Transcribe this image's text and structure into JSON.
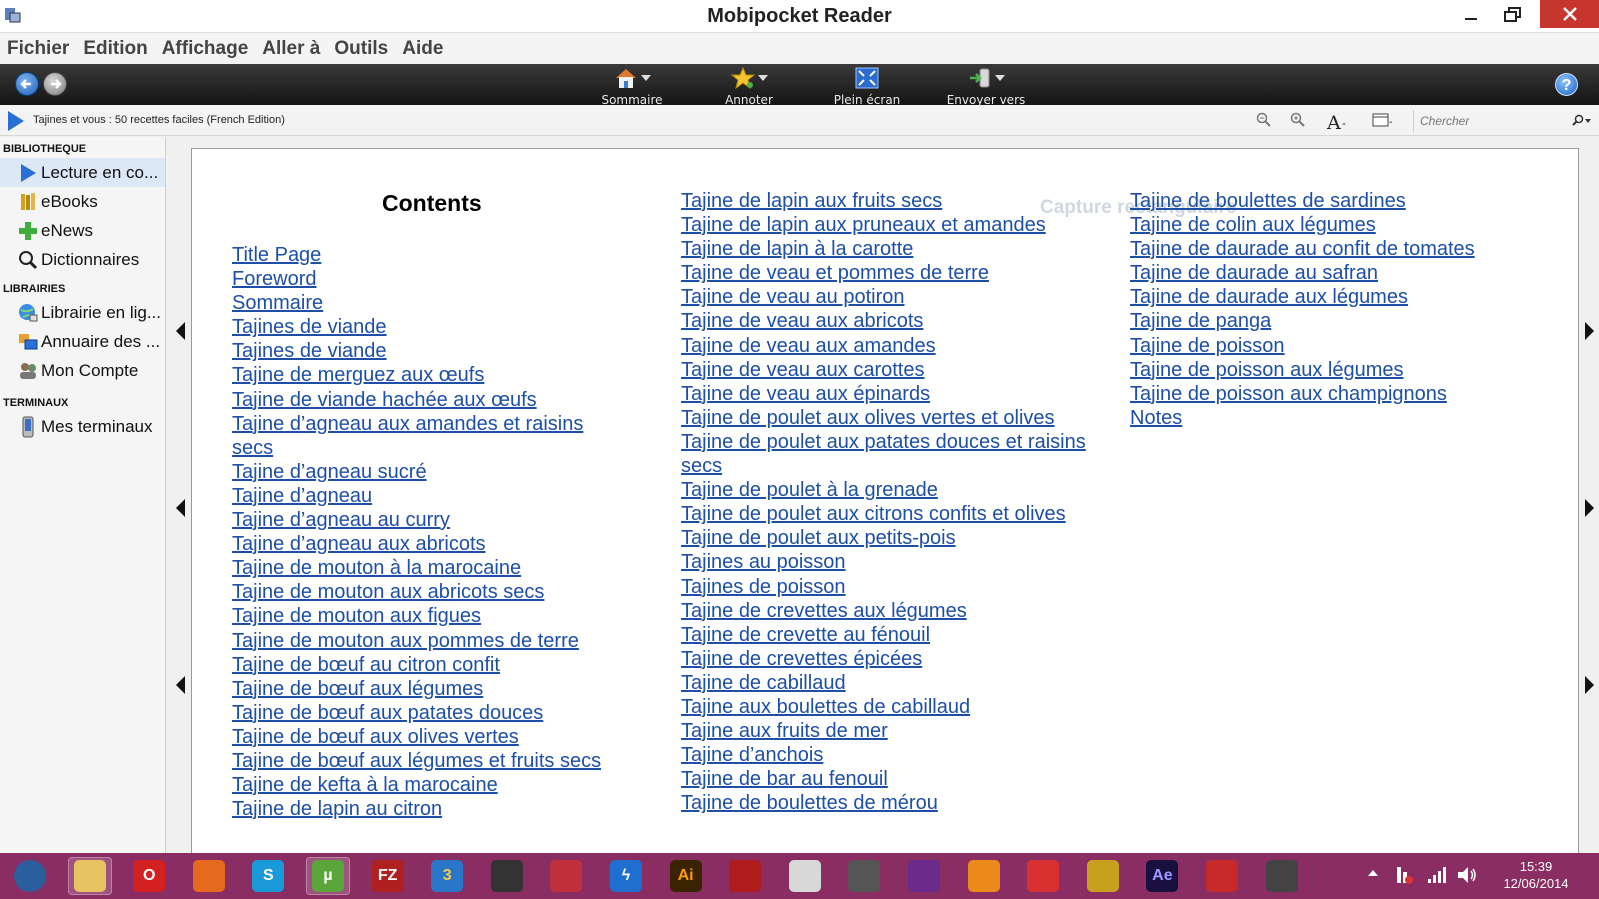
{
  "window": {
    "title": "Mobipocket Reader"
  },
  "menu": [
    "Fichier",
    "Edition",
    "Affichage",
    "Aller à",
    "Outils",
    "Aide"
  ],
  "toolbar": {
    "items": [
      {
        "label": "Sommaire",
        "icon": "home-icon"
      },
      {
        "label": "Annoter",
        "icon": "star-icon"
      },
      {
        "label": "Plein écran",
        "icon": "fullscreen-icon"
      },
      {
        "label": "Envoyer vers",
        "icon": "send-device-icon"
      }
    ],
    "help": "?"
  },
  "bookbar": {
    "book_title": "Tajines et vous : 50 recettes faciles (French Edition)",
    "search_placeholder": "Chercher"
  },
  "sidebar": {
    "sections": [
      {
        "title": "BIBLIOTHEQUE",
        "items": [
          {
            "label": "Lecture en co...",
            "icon": "reading-icon",
            "selected": true
          },
          {
            "label": "eBooks",
            "icon": "books-icon"
          },
          {
            "label": "eNews",
            "icon": "plus-icon"
          },
          {
            "label": "Dictionnaires",
            "icon": "magnifier-icon"
          }
        ]
      },
      {
        "title": "LIBRAIRIES",
        "items": [
          {
            "label": "Librairie en lig...",
            "icon": "globe-icon"
          },
          {
            "label": "Annuaire des ...",
            "icon": "directory-icon"
          },
          {
            "label": "Mon Compte",
            "icon": "account-icon"
          }
        ]
      },
      {
        "title": "TERMINAUX",
        "items": [
          {
            "label": "Mes terminaux",
            "icon": "device-icon"
          }
        ]
      }
    ]
  },
  "content": {
    "heading": "Contents",
    "watermark": "Capture rectangulaire",
    "col1": [
      "Title Page",
      "Foreword",
      "Sommaire",
      "Tajines de viande",
      "Tajines de viande",
      "Tajine de merguez aux œufs",
      "Tajine de viande hachée aux œufs",
      "Tajine d’agneau aux amandes et raisins secs",
      "Tajine d’agneau sucré",
      "Tajine d’agneau",
      "Tajine d’agneau au curry",
      "Tajine d’agneau aux abricots",
      "Tajine de mouton à la marocaine",
      "Tajine de mouton aux abricots secs",
      "Tajine de mouton aux figues",
      "Tajine de mouton aux pommes de terre",
      "Tajine de bœuf au citron confit",
      "Tajine de bœuf aux légumes",
      "Tajine de bœuf aux patates douces",
      "Tajine de bœuf aux olives vertes",
      "Tajine de bœuf aux légumes et fruits secs",
      "Tajine de kefta à la marocaine",
      "Tajine de lapin au citron"
    ],
    "col2": [
      "Tajine de lapin aux fruits secs",
      "Tajine de lapin aux pruneaux et amandes",
      "Tajine de lapin à la carotte",
      "Tajine de veau et pommes de terre",
      "Tajine de veau au potiron",
      "Tajine de veau aux abricots",
      "Tajine de veau aux amandes",
      "Tajine de veau aux carottes",
      "Tajine de veau aux épinards",
      "Tajine de poulet aux olives vertes et olives",
      "Tajine de poulet aux patates douces et raisins secs",
      "Tajine de poulet à la grenade",
      "Tajine de poulet aux citrons confits et olives",
      "Tajine de poulet aux petits-pois",
      "Tajines au poisson",
      "Tajines de poisson",
      "Tajine de crevettes aux légumes",
      "Tajine de crevette au fénouil",
      "Tajine de crevettes épicées",
      "Tajine de cabillaud",
      "Tajine aux boulettes de cabillaud",
      "Tajine aux fruits de mer",
      "Tajine d’anchois",
      "Tajine de bar au fenouil",
      "Tajine de boulettes de mérou"
    ],
    "col3": [
      "Tajine de boulettes de sardines",
      "Tajine de colin aux légumes",
      "Tajine de daurade au confit de tomates",
      "Tajine de daurade au safran",
      "Tajine de daurade aux légumes",
      "Tajine de panga",
      "Tajine de poisson",
      "Tajine de poisson aux légumes",
      "Tajine de poisson aux champignons",
      "Notes"
    ]
  },
  "taskbar": {
    "apps": [
      {
        "name": "start-button",
        "label": ""
      },
      {
        "name": "file-explorer-icon",
        "label": ""
      },
      {
        "name": "opera-icon",
        "label": "O"
      },
      {
        "name": "firefox-icon",
        "label": ""
      },
      {
        "name": "skype-icon",
        "label": "S"
      },
      {
        "name": "utorrent-icon",
        "label": "µ"
      },
      {
        "name": "filezilla-icon",
        "label": "FZ"
      },
      {
        "name": "app-3-icon",
        "label": "3"
      },
      {
        "name": "keyboard-app-icon",
        "label": ""
      },
      {
        "name": "app-red-icon",
        "label": ""
      },
      {
        "name": "lightning-app-icon",
        "label": "ϟ"
      },
      {
        "name": "illustrator-icon",
        "label": "Ai"
      },
      {
        "name": "acrobat-icon",
        "label": ""
      },
      {
        "name": "scissors-app-icon",
        "label": ""
      },
      {
        "name": "printer-app-icon",
        "label": ""
      },
      {
        "name": "winrar-icon",
        "label": ""
      },
      {
        "name": "vlc-icon",
        "label": ""
      },
      {
        "name": "camera-app-icon",
        "label": ""
      },
      {
        "name": "yellow-app-icon",
        "label": ""
      },
      {
        "name": "after-effects-icon",
        "label": "Ae"
      },
      {
        "name": "red-app-icon",
        "label": ""
      },
      {
        "name": "game-app-icon",
        "label": ""
      }
    ],
    "time": "15:39",
    "date": "12/06/2014"
  },
  "colors": {
    "link": "#1d4fa6",
    "taskbar": "#8a2d63",
    "close": "#c7362e",
    "toolbar": "#1c1c1c"
  }
}
